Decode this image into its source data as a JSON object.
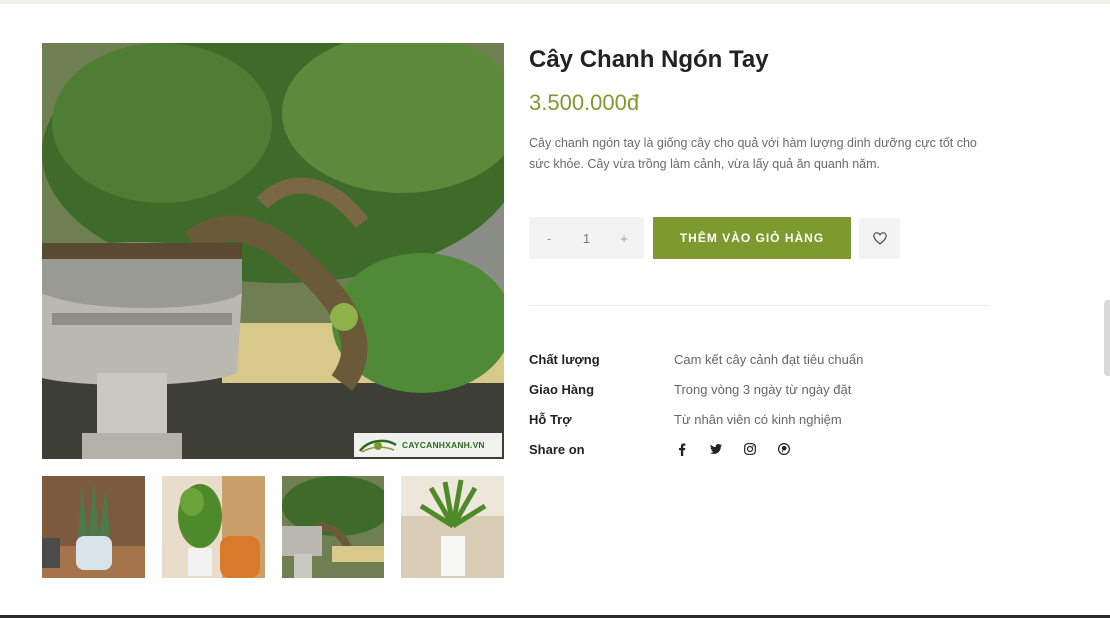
{
  "product": {
    "title": "Cây Chanh Ngón Tay",
    "price": "3.500.000đ",
    "description": "Cây chanh ngón tay là giống cây cho quả với hàm lượng dinh dưỡng cực tốt cho sức khỏe. Cây vừa trồng làm cảnh, vừa lấy quả ăn quanh năm."
  },
  "gallery": {
    "watermark_text": "CAYCANHXANH.VN",
    "thumbnails": [
      "aloe-in-glass-vase",
      "fiddle-leaf-fig-pot",
      "bonsai-lime-tree",
      "palm-in-white-pot"
    ]
  },
  "cart": {
    "minus_label": "-",
    "quantity": "1",
    "plus_label": "+",
    "add_to_cart_label": "THÊM VÀO GIỎ HÀNG",
    "wishlist_icon": "heart-icon"
  },
  "meta": [
    {
      "label": "Chất lượng",
      "value": "Cam kết cây cảnh đạt tiêu chuẩn"
    },
    {
      "label": "Giao Hàng",
      "value": "Trong vòng 3 ngày từ ngày đặt"
    },
    {
      "label": "Hỗ Trợ",
      "value": "Từ nhân viên có kinh nghiệm"
    }
  ],
  "share": {
    "label": "Share on",
    "icons": [
      "facebook-icon",
      "twitter-icon",
      "instagram-icon",
      "pinterest-icon"
    ]
  },
  "colors": {
    "accent": "#7d9a2f",
    "title": "#222222",
    "text_muted": "#6b6b6b",
    "light_bg": "#f3f3f3"
  }
}
